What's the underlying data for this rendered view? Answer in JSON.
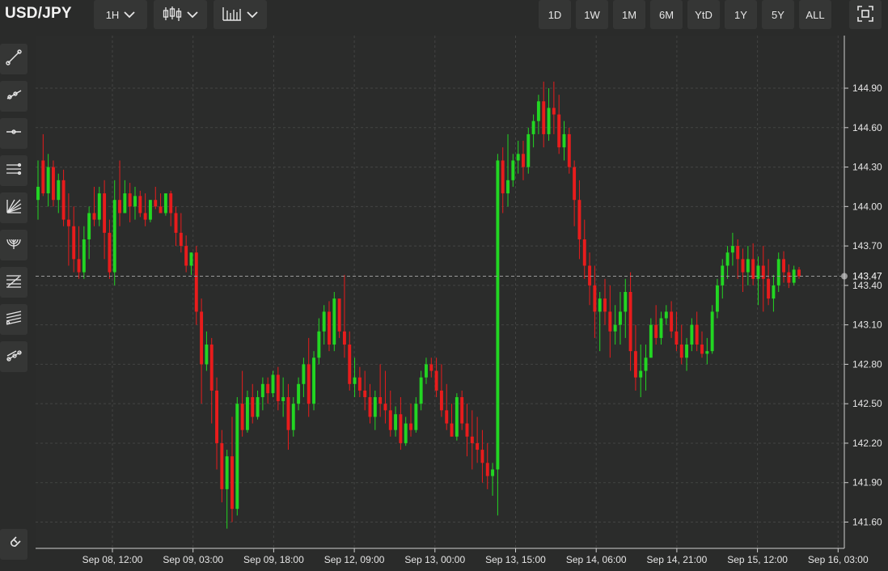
{
  "header": {
    "symbol": "USD/JPY",
    "interval": {
      "label": "1H",
      "icon": "chevron-down-icon"
    },
    "chart_type": {
      "icon": "candlestick-icon"
    },
    "indicators": {
      "icon": "bar-chart-icon"
    },
    "ranges": [
      "1D",
      "1W",
      "1M",
      "6M",
      "YtD",
      "1Y",
      "5Y",
      "ALL"
    ],
    "fullscreen_icon": "fullscreen-icon"
  },
  "sidebar": {
    "tools": [
      {
        "name": "trend-line-tool",
        "icon": "trend-line-icon"
      },
      {
        "name": "ray-tool",
        "icon": "ray-icon"
      },
      {
        "name": "horizontal-line-tool",
        "icon": "horizontal-line-icon"
      },
      {
        "name": "channel-tool",
        "icon": "parallel-channel-icon"
      },
      {
        "name": "fib-fan-tool",
        "icon": "fib-fan-icon"
      },
      {
        "name": "fib-arc-tool",
        "icon": "fib-arc-icon"
      },
      {
        "name": "fib-retracement-tool",
        "icon": "fib-retracement-icon"
      },
      {
        "name": "fib-extension-tool",
        "icon": "fib-extension-icon"
      },
      {
        "name": "pitchfork-tool",
        "icon": "pitchfork-icon"
      }
    ],
    "magnet_icon": "magnet-icon"
  },
  "colors": {
    "up": "#22d622",
    "down": "#e81c1c",
    "background": "#2a2b2a",
    "grid": "#434443"
  },
  "chart_data": {
    "type": "candlestick",
    "title": "USD/JPY",
    "xlabel": "",
    "ylabel": "",
    "ylim": [
      141.4,
      145.3
    ],
    "yticks": [
      141.6,
      141.9,
      142.2,
      142.5,
      142.8,
      143.1,
      143.4,
      143.7,
      144.0,
      144.3,
      144.6,
      144.9
    ],
    "ytick_labels": [
      "141.60",
      "141.90",
      "142.20",
      "142.50",
      "142.80",
      "143.10",
      "143.40",
      "143.70",
      "144.00",
      "144.30",
      "144.60",
      "144.90"
    ],
    "xtick_labels": [
      "Sep 08, 12:00",
      "Sep 09, 03:00",
      "Sep 09, 18:00",
      "Sep 12, 09:00",
      "Sep 13, 00:00",
      "Sep 13, 15:00",
      "Sep 14, 06:00",
      "Sep 14, 21:00",
      "Sep 15, 12:00",
      "Sep 16, 03:00"
    ],
    "last_price": 143.47,
    "last_price_label": "143.47",
    "grid": true,
    "candles": [
      [
        144.05,
        144.35,
        144.15,
        143.9
      ],
      [
        144.35,
        144.55,
        144.1,
        144.08
      ],
      [
        144.1,
        144.4,
        144.3,
        144.0
      ],
      [
        144.3,
        144.35,
        144.05,
        144.0
      ],
      [
        144.05,
        144.25,
        144.2,
        143.95
      ],
      [
        144.2,
        144.28,
        143.9,
        143.85
      ],
      [
        143.9,
        144.1,
        143.85,
        143.55
      ],
      [
        143.85,
        144.0,
        143.6,
        143.5
      ],
      [
        143.6,
        143.85,
        143.5,
        143.45
      ],
      [
        143.5,
        143.85,
        143.75,
        143.45
      ],
      [
        143.75,
        144.0,
        143.95,
        143.6
      ],
      [
        143.95,
        144.15,
        143.9,
        143.85
      ],
      [
        143.9,
        144.15,
        144.1,
        143.85
      ],
      [
        144.1,
        144.2,
        143.8,
        143.6
      ],
      [
        143.8,
        143.9,
        143.5,
        143.45
      ],
      [
        143.5,
        144.2,
        144.05,
        143.4
      ],
      [
        144.05,
        144.35,
        143.95,
        143.85
      ],
      [
        143.95,
        144.2,
        144.1,
        143.95
      ],
      [
        144.1,
        144.18,
        144.0,
        143.88
      ],
      [
        144.0,
        144.15,
        144.08,
        143.9
      ],
      [
        144.08,
        144.12,
        143.95,
        143.92
      ],
      [
        143.95,
        144.1,
        143.9,
        143.85
      ],
      [
        143.9,
        144.05,
        144.05,
        143.88
      ],
      [
        144.05,
        144.15,
        144.0,
        143.98
      ],
      [
        144.0,
        144.1,
        143.95,
        143.95
      ],
      [
        143.95,
        144.1,
        144.1,
        143.93
      ],
      [
        144.1,
        144.12,
        143.95,
        143.85
      ],
      [
        143.95,
        144.0,
        143.8,
        143.7
      ],
      [
        143.8,
        143.95,
        143.7,
        143.65
      ],
      [
        143.7,
        143.78,
        143.55,
        143.5
      ],
      [
        143.55,
        143.65,
        143.65,
        143.48
      ],
      [
        143.65,
        143.7,
        143.2,
        143.1
      ],
      [
        143.2,
        143.3,
        142.8,
        142.5
      ],
      [
        142.8,
        143.05,
        142.95,
        142.75
      ],
      [
        142.95,
        143.0,
        142.6,
        142.35
      ],
      [
        142.6,
        142.7,
        142.2,
        142.0
      ],
      [
        142.2,
        142.3,
        141.85,
        141.75
      ],
      [
        141.85,
        142.15,
        142.1,
        141.55
      ],
      [
        142.1,
        142.4,
        141.7,
        141.6
      ],
      [
        141.7,
        142.55,
        142.5,
        141.65
      ],
      [
        142.5,
        142.75,
        142.3,
        142.25
      ],
      [
        142.3,
        142.6,
        142.55,
        142.28
      ],
      [
        142.55,
        142.65,
        142.4,
        142.35
      ],
      [
        142.4,
        142.6,
        142.55,
        142.38
      ],
      [
        142.55,
        142.7,
        142.65,
        142.45
      ],
      [
        142.65,
        142.7,
        142.58,
        142.5
      ],
      [
        142.58,
        142.75,
        142.72,
        142.55
      ],
      [
        142.72,
        142.78,
        142.52,
        142.45
      ],
      [
        142.52,
        142.7,
        142.55,
        142.4
      ],
      [
        142.55,
        142.65,
        142.3,
        142.15
      ],
      [
        142.3,
        142.55,
        142.5,
        142.25
      ],
      [
        142.5,
        142.7,
        142.65,
        142.45
      ],
      [
        142.65,
        142.85,
        142.8,
        142.55
      ],
      [
        142.8,
        143.0,
        142.5,
        142.4
      ],
      [
        142.5,
        142.9,
        142.85,
        142.45
      ],
      [
        142.85,
        143.15,
        143.05,
        142.8
      ],
      [
        143.05,
        143.25,
        143.2,
        142.95
      ],
      [
        143.2,
        143.28,
        142.95,
        142.9
      ],
      [
        142.95,
        143.35,
        143.3,
        142.9
      ],
      [
        143.3,
        143.25,
        143.05,
        143.0
      ],
      [
        143.05,
        143.48,
        142.95,
        142.85
      ],
      [
        142.95,
        143.05,
        142.65,
        142.6
      ],
      [
        142.65,
        142.85,
        142.7,
        142.55
      ],
      [
        142.7,
        142.78,
        142.6,
        142.55
      ],
      [
        142.6,
        142.75,
        142.55,
        142.45
      ],
      [
        142.55,
        142.65,
        142.4,
        142.35
      ],
      [
        142.4,
        142.6,
        142.55,
        142.3
      ],
      [
        142.55,
        142.8,
        142.5,
        142.4
      ],
      [
        142.5,
        142.75,
        142.45,
        142.35
      ],
      [
        142.45,
        142.6,
        142.3,
        142.25
      ],
      [
        142.3,
        142.48,
        142.42,
        142.25
      ],
      [
        142.42,
        142.55,
        142.2,
        142.15
      ],
      [
        142.2,
        142.4,
        142.35,
        142.18
      ],
      [
        142.35,
        142.5,
        142.3,
        142.25
      ],
      [
        142.3,
        142.55,
        142.5,
        142.28
      ],
      [
        142.5,
        142.75,
        142.7,
        142.45
      ],
      [
        142.7,
        142.85,
        142.8,
        142.65
      ],
      [
        142.8,
        142.85,
        142.75,
        142.7
      ],
      [
        142.75,
        142.85,
        142.6,
        142.55
      ],
      [
        142.6,
        142.8,
        142.45,
        142.4
      ],
      [
        142.45,
        142.65,
        142.35,
        142.3
      ],
      [
        142.35,
        142.5,
        142.25,
        142.25
      ],
      [
        142.25,
        142.58,
        142.55,
        142.22
      ],
      [
        142.55,
        142.6,
        142.35,
        142.3
      ],
      [
        142.35,
        142.5,
        142.25,
        142.1
      ],
      [
        142.25,
        142.45,
        142.2,
        142.0
      ],
      [
        142.2,
        142.4,
        142.15,
        142.05
      ],
      [
        142.15,
        142.3,
        142.05,
        141.9
      ],
      [
        142.05,
        142.2,
        141.95,
        141.85
      ],
      [
        141.95,
        142.05,
        142.0,
        141.8
      ],
      [
        142.0,
        144.4,
        144.35,
        141.65
      ],
      [
        144.35,
        144.45,
        144.1,
        143.95
      ],
      [
        144.1,
        144.55,
        144.2,
        144.0
      ],
      [
        144.2,
        144.4,
        144.35,
        144.15
      ],
      [
        144.35,
        144.5,
        144.4,
        144.25
      ],
      [
        144.4,
        144.5,
        144.3,
        144.2
      ],
      [
        144.3,
        144.6,
        144.55,
        144.25
      ],
      [
        144.55,
        144.7,
        144.65,
        144.45
      ],
      [
        144.65,
        144.85,
        144.8,
        144.55
      ],
      [
        144.8,
        144.95,
        144.55,
        144.45
      ],
      [
        144.55,
        144.9,
        144.75,
        144.5
      ],
      [
        144.75,
        144.95,
        144.7,
        144.55
      ],
      [
        144.7,
        144.85,
        144.45,
        144.4
      ],
      [
        144.45,
        144.65,
        144.55,
        144.35
      ],
      [
        144.55,
        144.6,
        144.3,
        144.25
      ],
      [
        144.3,
        144.35,
        144.05,
        143.85
      ],
      [
        144.05,
        144.2,
        143.75,
        143.6
      ],
      [
        143.75,
        143.9,
        143.55,
        143.45
      ],
      [
        143.55,
        143.65,
        143.4,
        143.25
      ],
      [
        143.4,
        143.55,
        143.2,
        143.0
      ],
      [
        143.2,
        143.35,
        143.3,
        142.9
      ],
      [
        143.3,
        143.45,
        143.2,
        143.1
      ],
      [
        143.2,
        143.4,
        143.05,
        142.85
      ],
      [
        143.05,
        143.25,
        143.1,
        142.95
      ],
      [
        143.1,
        143.35,
        143.2,
        142.95
      ],
      [
        143.2,
        143.45,
        143.35,
        143.0
      ],
      [
        143.35,
        143.5,
        142.9,
        142.75
      ],
      [
        142.9,
        143.1,
        142.7,
        142.6
      ],
      [
        142.7,
        142.95,
        142.75,
        142.55
      ],
      [
        142.75,
        142.95,
        142.85,
        142.6
      ],
      [
        142.85,
        143.15,
        143.1,
        142.85
      ],
      [
        143.1,
        143.25,
        143.0,
        142.95
      ],
      [
        143.0,
        143.2,
        143.15,
        142.95
      ],
      [
        143.15,
        143.25,
        143.2,
        143.1
      ],
      [
        143.2,
        143.28,
        143.05,
        143.0
      ],
      [
        143.05,
        143.2,
        142.95,
        142.9
      ],
      [
        142.95,
        143.1,
        142.85,
        142.8
      ],
      [
        142.85,
        143.0,
        142.95,
        142.75
      ],
      [
        142.95,
        143.15,
        143.1,
        142.9
      ],
      [
        143.1,
        143.2,
        142.95,
        142.9
      ],
      [
        142.95,
        143.05,
        142.88,
        142.85
      ],
      [
        142.88,
        143.0,
        142.9,
        142.8
      ],
      [
        142.9,
        143.25,
        143.2,
        142.88
      ],
      [
        143.2,
        143.45,
        143.4,
        143.15
      ],
      [
        143.4,
        143.6,
        143.55,
        143.3
      ],
      [
        143.55,
        143.7,
        143.65,
        143.45
      ],
      [
        143.65,
        143.8,
        143.7,
        143.55
      ],
      [
        143.7,
        143.75,
        143.6,
        143.45
      ],
      [
        143.6,
        143.68,
        143.5,
        143.35
      ],
      [
        143.5,
        143.7,
        143.6,
        143.4
      ],
      [
        143.6,
        143.72,
        143.45,
        143.4
      ],
      [
        143.45,
        143.62,
        143.55,
        143.25
      ],
      [
        143.55,
        143.7,
        143.45,
        143.2
      ],
      [
        143.45,
        143.6,
        143.3,
        143.25
      ],
      [
        143.3,
        143.48,
        143.4,
        143.2
      ],
      [
        143.4,
        143.65,
        143.6,
        143.35
      ],
      [
        143.6,
        143.66,
        143.5,
        143.42
      ],
      [
        143.5,
        143.56,
        143.42,
        143.38
      ],
      [
        143.42,
        143.55,
        143.52,
        143.4
      ],
      [
        143.52,
        143.54,
        143.47,
        143.45
      ]
    ]
  }
}
